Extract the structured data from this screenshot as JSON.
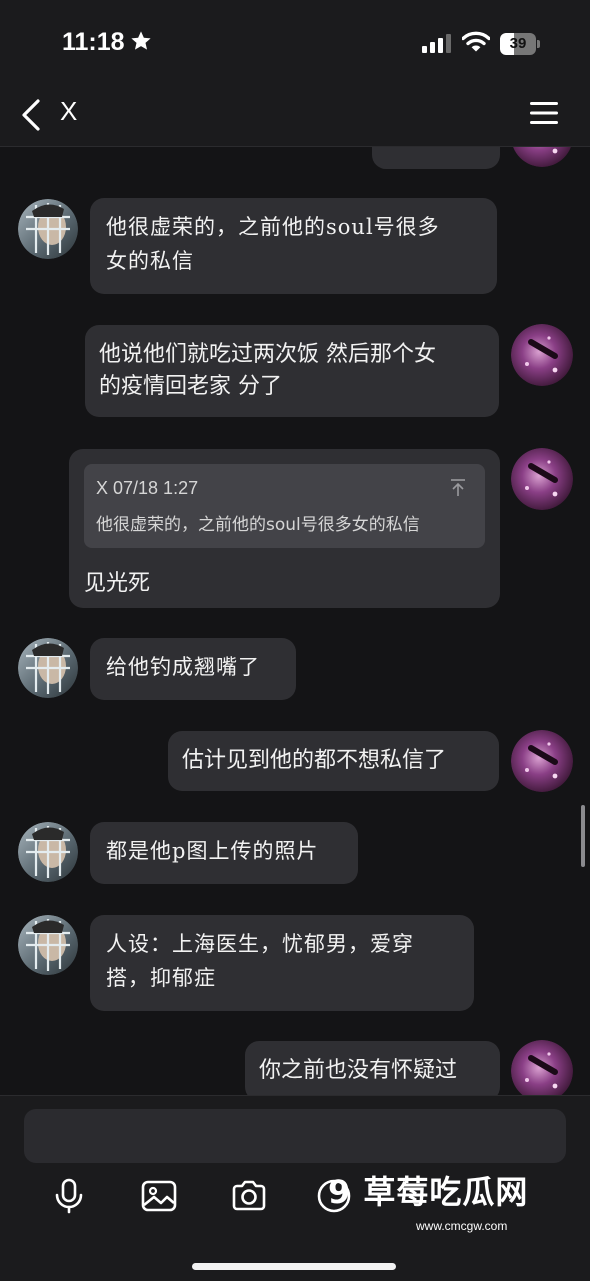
{
  "status_bar": {
    "time": "11:18",
    "battery": "39",
    "battery_fraction": 0.39
  },
  "nav": {
    "title": "X"
  },
  "messages": [
    {
      "id": "m0",
      "sender": "self",
      "text": "",
      "partial": true
    },
    {
      "id": "m1",
      "sender": "friend",
      "lines": [
        "他很虚荣的，之前他的soul号很多",
        "女的私信"
      ]
    },
    {
      "id": "m2",
      "sender": "self",
      "lines": [
        "他说他们就吃过两次饭 然后那个女",
        "的疫情回老家 分了"
      ]
    },
    {
      "id": "m3",
      "sender": "self",
      "quote": {
        "meta": "X 07/18 1:27",
        "text": "他很虚荣的，之前他的soul号很多女的私信"
      },
      "text": "见光死"
    },
    {
      "id": "m4",
      "sender": "friend",
      "lines": [
        "给他钓成翘嘴了"
      ]
    },
    {
      "id": "m5",
      "sender": "self",
      "lines": [
        "估计见到他的都不想私信了"
      ]
    },
    {
      "id": "m6",
      "sender": "friend",
      "lines": [
        "都是他p图上传的照片"
      ]
    },
    {
      "id": "m7",
      "sender": "friend",
      "lines": [
        "人设：上海医生，忧郁男，爱穿",
        "搭，抑郁症"
      ]
    },
    {
      "id": "m8",
      "sender": "self",
      "lines": [
        "你之前也没有怀疑过"
      ]
    }
  ],
  "input": {
    "value": "",
    "placeholder": ""
  },
  "toolbar": {
    "icons": [
      "microphone-icon",
      "image-icon",
      "camera-icon",
      "sticker-icon"
    ]
  },
  "watermark": {
    "title": "9 草莓吃瓜网",
    "url": "www.cmcgw.com"
  },
  "colors": {
    "background": "#141416",
    "bar": "#1b1b1d",
    "bubble": "#2f2f33",
    "quote": "#434348",
    "text": "#f2f2f2"
  }
}
